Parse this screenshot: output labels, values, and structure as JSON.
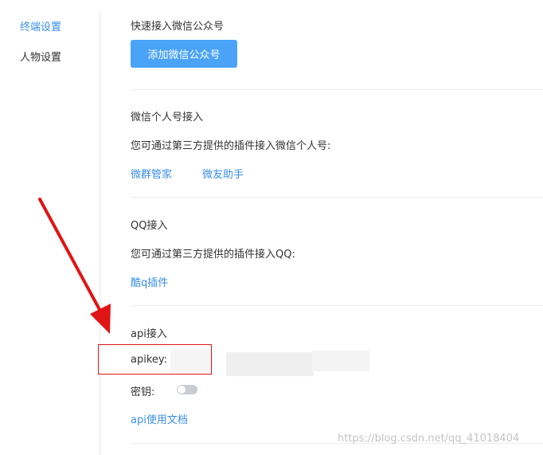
{
  "sidebar": {
    "items": [
      {
        "label": "终端设置",
        "active": true
      },
      {
        "label": "人物设置",
        "active": false
      }
    ]
  },
  "wechat_official": {
    "title": "快速接入微信公众号",
    "button_label": "添加微信公众号"
  },
  "wechat_personal": {
    "title": "微信个人号接入",
    "description": "您可通过第三方提供的插件接入微信个人号:",
    "links": [
      "微群管家",
      "微友助手"
    ]
  },
  "qq": {
    "title": "QQ接入",
    "description": "您可通过第三方提供的插件接入QQ:",
    "link": "酷q插件"
  },
  "api": {
    "title": "api接入",
    "apikey_label": "apikey:",
    "secret_label": "密钥:",
    "secret_enabled": false,
    "docs_link": "api使用文档"
  },
  "watermark": "https://blog.csdn.net/qq_41018404",
  "colors": {
    "accent": "#3a8ee6",
    "button": "#4aa3f7",
    "annotation": "#e01515"
  }
}
